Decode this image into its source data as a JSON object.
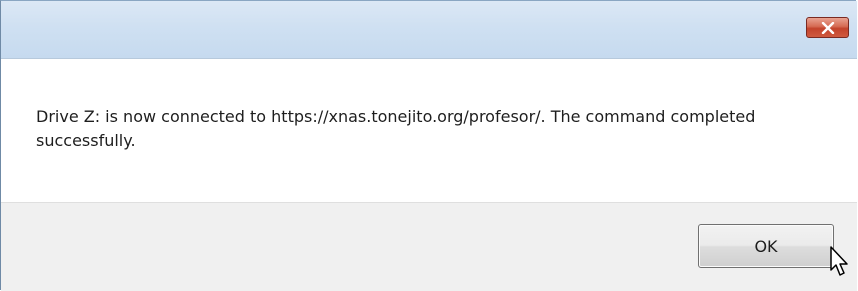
{
  "dialog": {
    "title": "",
    "close_icon": "close-x-icon",
    "message": "Drive Z: is now connected to https://xnas.tonejito.org/profesor/.  The command completed successfully.",
    "ok_label": "OK",
    "pointer_icon": "mouse-pointer-icon"
  },
  "colors": {
    "close_button": "#c3432c",
    "titlebar": "#cfe0f2",
    "footer": "#f0f0f0"
  }
}
